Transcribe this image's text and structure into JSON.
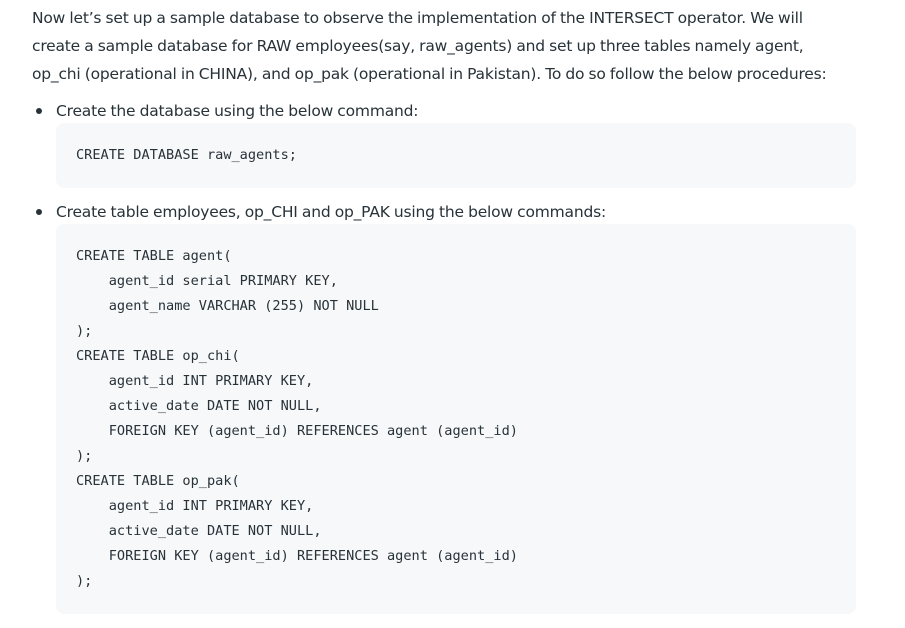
{
  "intro": {
    "lines": [
      "Now let’s set up a sample database to observe the implementation of the INTERSECT operator. We will",
      "create a sample database for RAW employees(say, raw_agents) and set up three tables namely agent,",
      "op_chi (operational in CHINA), and op_pak (operational in Pakistan). To do so follow the below procedures:"
    ]
  },
  "steps": [
    {
      "text": "Create the database using the below command:",
      "code": [
        "CREATE DATABASE raw_agents;"
      ]
    },
    {
      "text": "Create table employees, op_CHI and op_PAK using the below commands:",
      "code": [
        "CREATE TABLE agent(",
        "    agent_id serial PRIMARY KEY,",
        "    agent_name VARCHAR (255) NOT NULL",
        ");",
        "CREATE TABLE op_chi(",
        "    agent_id INT PRIMARY KEY,",
        "    active_date DATE NOT NULL,",
        "    FOREIGN KEY (agent_id) REFERENCES agent (agent_id)",
        ");",
        "CREATE TABLE op_pak(",
        "    agent_id INT PRIMARY KEY,",
        "    active_date DATE NOT NULL,",
        "    FOREIGN KEY (agent_id) REFERENCES agent (agent_id)",
        ");"
      ]
    }
  ]
}
